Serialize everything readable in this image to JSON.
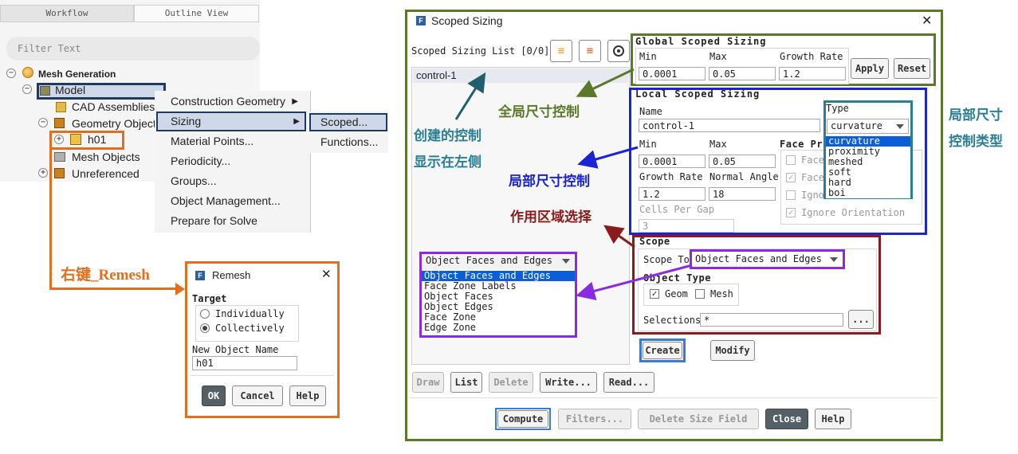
{
  "tabs": {
    "workflow": "Workflow",
    "outline": "Outline View"
  },
  "filter_placeholder": "Filter Text",
  "tree": {
    "root": "Mesh Generation",
    "model": "Model",
    "cad": "CAD Assemblies",
    "geom": "Geometry Objects",
    "h01": "h01",
    "mesh_objects": "Mesh Objects",
    "unreferenced": "Unreferenced"
  },
  "context_menu": {
    "items": [
      "Construction Geometry",
      "Sizing",
      "Material Points...",
      "Periodicity...",
      "Groups...",
      "Object Management...",
      "Prepare for Solve"
    ]
  },
  "submenu": {
    "items": [
      "Scoped...",
      "Functions..."
    ]
  },
  "annotations": {
    "right_click": "右键_Remesh",
    "global_ctrl": "全局尺寸控制",
    "created_1": "创建的控制",
    "created_2": "显示在左侧",
    "local_ctrl": "局部尺寸控制",
    "scope_select": "作用区域选择",
    "local_type_1": "局部尺寸",
    "local_type_2": "控制类型"
  },
  "remesh": {
    "title": "Remesh",
    "target_label": "Target",
    "individually": "Individually",
    "collectively": "Collectively",
    "name_label": "New Object Name",
    "name_value": "h01",
    "ok": "OK",
    "cancel": "Cancel",
    "help": "Help"
  },
  "scoped": {
    "title": "Scoped Sizing",
    "list_label": "Scoped Sizing List [0/0]",
    "list_items": [
      "control-1"
    ],
    "global": {
      "title": "Global Scoped Sizing",
      "min_label": "Min",
      "max_label": "Max",
      "gr_label": "Growth Rate",
      "min": "0.0001",
      "max": "0.05",
      "gr": "1.2",
      "apply": "Apply",
      "reset": "Reset"
    },
    "local": {
      "title": "Local Scoped Sizing",
      "name_label": "Name",
      "name": "control-1",
      "type_label": "Type",
      "type": "curvature",
      "type_options": [
        "curvature",
        "proximity",
        "meshed",
        "soft",
        "hard",
        "boi"
      ],
      "min_label": "Min",
      "max_label": "Max",
      "min": "0.0001",
      "max": "0.05",
      "gr_label": "Growth Rate",
      "na_label": "Normal Angle",
      "gr": "1.2",
      "na": "18",
      "cpg_label": "Cells Per Gap",
      "cpg": "3",
      "face_prox_label": "Face Pr",
      "face1": "Face",
      "face2": "Face",
      "ignore1": "Igno",
      "ignore_orient": "Ignore Orientation"
    },
    "scope": {
      "title": "Scope",
      "scope_to_label": "Scope To",
      "scope_to": "Object Faces and Edges",
      "object_type_label": "Object Type",
      "geom": "Geom",
      "mesh": "Mesh",
      "selections_label": "Selections",
      "selections": "*",
      "dots": "..."
    },
    "scope_dropdown": {
      "value": "Object Faces and Edges",
      "options": [
        "Object Faces and Edges",
        "Face Zone Labels",
        "Object Faces",
        "Object Edges",
        "Face Zone",
        "Edge Zone"
      ]
    },
    "create": "Create",
    "modify": "Modify",
    "draw": "Draw",
    "list": "List",
    "delete": "Delete",
    "write": "Write...",
    "read": "Read...",
    "compute": "Compute",
    "filters": "Filters...",
    "delete_size_field": "Delete Size Field",
    "close": "Close",
    "help": "Help"
  },
  "colors": {
    "green": "#5a7a2a",
    "blue": "#1a24d6",
    "darkred": "#8b1a1a",
    "purple": "#8a2be2",
    "teal": "#2a7f95",
    "orange": "#e07020",
    "navy": "#1f3a5f"
  }
}
